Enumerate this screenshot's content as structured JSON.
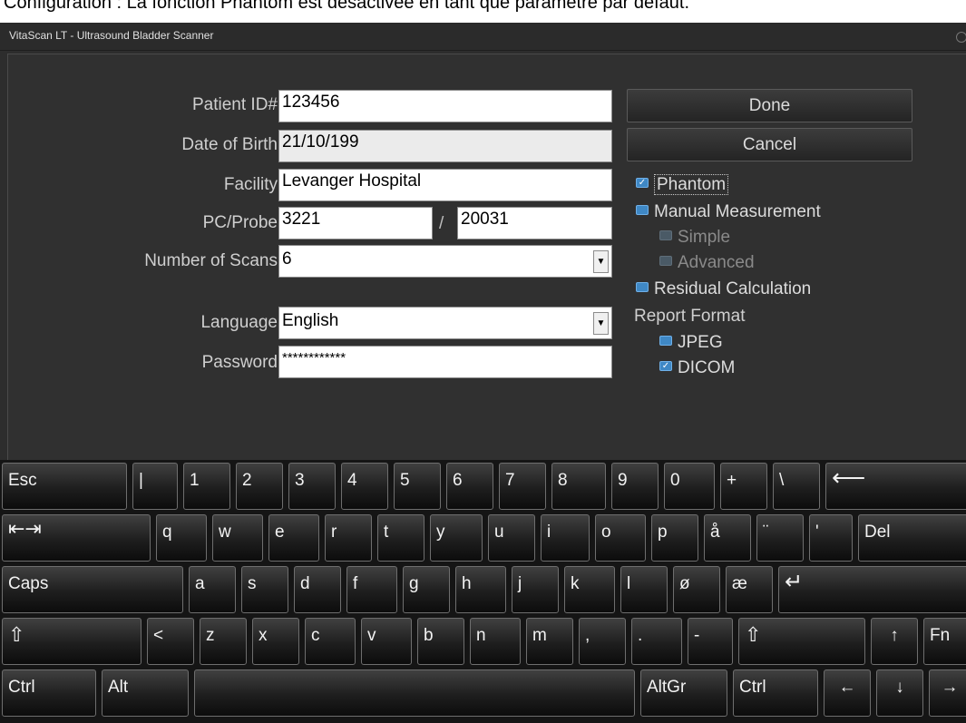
{
  "caption": "Configuration : La fonction Phantom est désactivée en tant que paramètre par défaut.",
  "window": {
    "title": "VitaScan LT - Ultrasound Bladder Scanner"
  },
  "form": {
    "patient_id": {
      "label": "Patient ID#",
      "value": "123456"
    },
    "dob": {
      "label": "Date of Birth",
      "value": "21/10/199"
    },
    "facility": {
      "label": "Facility",
      "value": "Levanger Hospital"
    },
    "pc_probe": {
      "label": "PC/Probe",
      "pc_value": "3221",
      "separator": "/",
      "probe_value": "20031"
    },
    "num_scans": {
      "label": "Number of Scans",
      "value": "6"
    },
    "language": {
      "label": "Language",
      "value": "English"
    },
    "password": {
      "label": "Password",
      "value": "************"
    }
  },
  "actions": {
    "done": "Done",
    "cancel": "Cancel"
  },
  "options": {
    "phantom": {
      "label": "Phantom",
      "checked": true
    },
    "manual_measurement": {
      "label": "Manual Measurement",
      "checked": false
    },
    "simple": {
      "label": "Simple",
      "checked": false,
      "disabled": true
    },
    "advanced": {
      "label": "Advanced",
      "checked": false,
      "disabled": true
    },
    "residual_calculation": {
      "label": "Residual Calculation",
      "checked": false
    },
    "report_format": {
      "label": "Report Format"
    },
    "jpeg": {
      "label": "JPEG",
      "checked": false
    },
    "dicom": {
      "label": "DICOM",
      "checked": true
    }
  },
  "icons": {
    "dropdown": "chevron-down-icon",
    "checked": "check-icon",
    "backspace": "backspace-icon",
    "tab": "tab-icon",
    "enter": "enter-icon",
    "shift": "shift-icon"
  },
  "colors": {
    "background": "#2d2d2d",
    "checkbox": "#3f88c5",
    "input_bg": "#ffffff"
  },
  "keyboard": {
    "row1": [
      "Esc",
      "|",
      "1",
      "2",
      "3",
      "4",
      "5",
      "6",
      "7",
      "8",
      "9",
      "0",
      "+",
      "\\",
      "⟵"
    ],
    "row2": [
      "⇤⇥",
      "q",
      "w",
      "e",
      "r",
      "t",
      "y",
      "u",
      "i",
      "o",
      "p",
      "å",
      "¨",
      "'",
      "Del"
    ],
    "row3": [
      "Caps",
      "a",
      "s",
      "d",
      "f",
      "g",
      "h",
      "j",
      "k",
      "l",
      "ø",
      "æ",
      "↵"
    ],
    "row4": [
      "⇧",
      "<",
      "z",
      "x",
      "c",
      "v",
      "b",
      "n",
      "m",
      ",",
      ".",
      "-",
      "⇧",
      "↑",
      "Fn"
    ],
    "row5": [
      "Ctrl",
      "Alt",
      "",
      "AltGr",
      "Ctrl",
      "←",
      "↓",
      "→"
    ]
  }
}
